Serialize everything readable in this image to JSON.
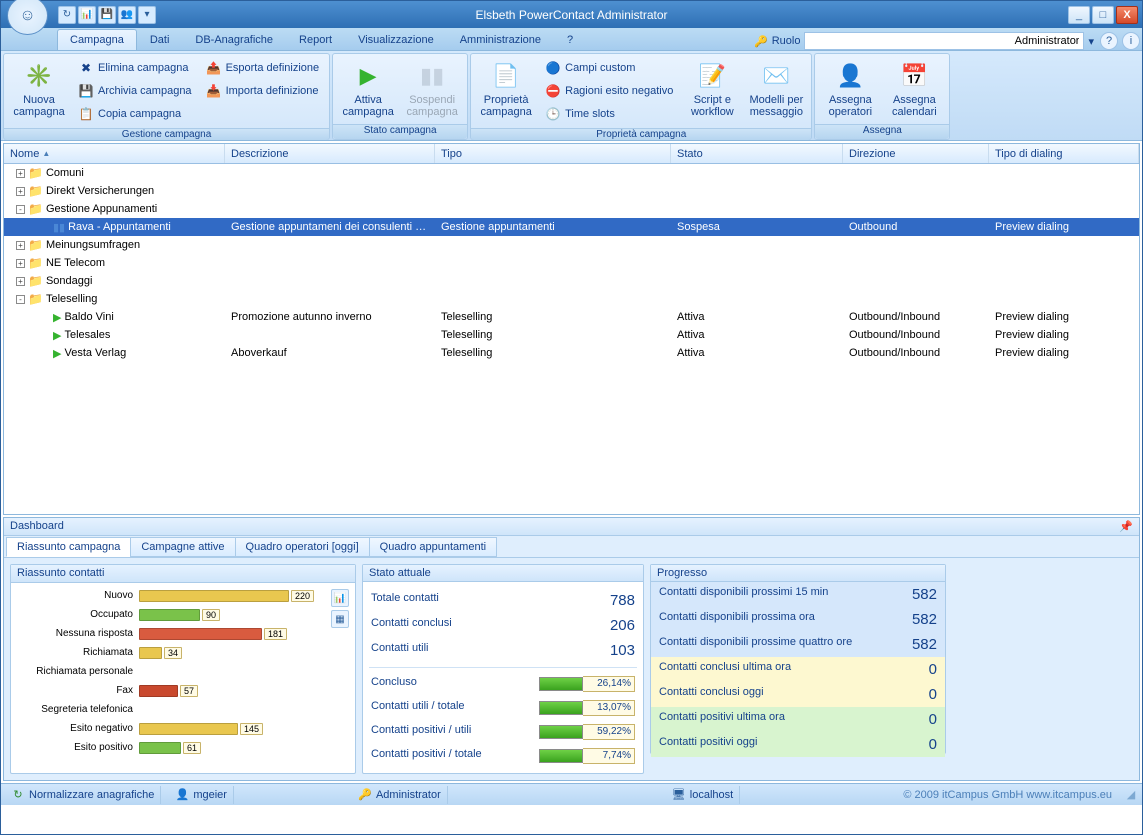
{
  "app_title": "Elsbeth PowerContact Administrator",
  "qat": [
    "↻",
    "📊",
    "💾",
    "👥",
    "▾"
  ],
  "window_buttons": {
    "min": "_",
    "max": "□",
    "close": "X"
  },
  "menu_tabs": [
    "Campagna",
    "Dati",
    "DB-Anagrafiche",
    "Report",
    "Visualizzazione",
    "Amministrazione",
    "?"
  ],
  "ruolo_label": "Ruolo",
  "ruolo_value": "Administrator",
  "ribbon_groups": {
    "gestione": {
      "label": "Gestione campagna",
      "big": {
        "label": "Nuova campagna"
      },
      "col1": [
        "Elimina campagna",
        "Archivia campagna",
        "Copia campagna"
      ],
      "col2": [
        "Esporta definizione",
        "Importa definizione"
      ]
    },
    "stato": {
      "label": "Stato campagna",
      "attiva": "Attiva campagna",
      "sospendi": "Sospendi campagna"
    },
    "proprieta": {
      "label": "Proprietà campagna",
      "big": "Proprietà campagna",
      "col": [
        "Campi custom",
        "Ragioni esito negativo",
        "Time slots"
      ],
      "script": "Script e workflow",
      "modelli": "Modelli per messaggio"
    },
    "assegna": {
      "label": "Assegna",
      "op": "Assegna operatori",
      "cal": "Assegna calendari"
    }
  },
  "grid_cols": [
    "Nome",
    "Descrizione",
    "Tipo",
    "Stato",
    "Direzione",
    "Tipo di dialing"
  ],
  "tree": [
    {
      "t": "folder",
      "exp": "+",
      "depth": 0,
      "name": "Comuni"
    },
    {
      "t": "folder",
      "exp": "+",
      "depth": 0,
      "name": "Direkt Versicherungen"
    },
    {
      "t": "folder",
      "exp": "-",
      "depth": 0,
      "name": "Gestione Appunamenti"
    },
    {
      "t": "camp",
      "icon": "pause",
      "depth": 1,
      "sel": true,
      "name": "Rava - Appuntamenti",
      "desc": "Gestione appuntameni dei consulenti di ...",
      "tipo": "Gestione appuntamenti",
      "stato": "Sospesa",
      "dir": "Outbound",
      "dial": "Preview dialing"
    },
    {
      "t": "folder",
      "exp": "+",
      "depth": 0,
      "name": "Meinungsumfragen"
    },
    {
      "t": "folder",
      "exp": "+",
      "depth": 0,
      "name": "NE Telecom"
    },
    {
      "t": "folder",
      "exp": "+",
      "depth": 0,
      "name": "Sondaggi"
    },
    {
      "t": "folder",
      "exp": "-",
      "depth": 0,
      "name": "Teleselling"
    },
    {
      "t": "camp",
      "icon": "play",
      "depth": 1,
      "name": "Baldo Vini",
      "desc": "Promozione autunno inverno",
      "tipo": "Teleselling",
      "stato": "Attiva",
      "dir": "Outbound/Inbound",
      "dial": "Preview dialing"
    },
    {
      "t": "camp",
      "icon": "play",
      "depth": 1,
      "name": "Telesales",
      "desc": "",
      "tipo": "Teleselling",
      "stato": "Attiva",
      "dir": "Outbound/Inbound",
      "dial": "Preview dialing"
    },
    {
      "t": "camp",
      "icon": "play",
      "depth": 1,
      "name": "Vesta Verlag",
      "desc": "Aboverkauf",
      "tipo": "Teleselling",
      "stato": "Attiva",
      "dir": "Outbound/Inbound",
      "dial": "Preview dialing"
    }
  ],
  "dashboard_title": "Dashboard",
  "dash_tabs": [
    "Riassunto campagna",
    "Campagne attive",
    "Quadro operatori [oggi]",
    "Quadro appuntamenti"
  ],
  "panel_titles": {
    "chart": "Riassunto contatti",
    "stato": "Stato attuale",
    "prog": "Progresso"
  },
  "chart_data": {
    "type": "bar",
    "orientation": "horizontal",
    "categories": [
      "Nuovo",
      "Occupato",
      "Nessuna risposta",
      "Richiamata",
      "Richiamata personale",
      "Fax",
      "Segreteria telefonica",
      "Esito negativo",
      "Esito positivo"
    ],
    "values": [
      220,
      90,
      181,
      34,
      0,
      57,
      0,
      145,
      61
    ],
    "max": 220,
    "colors": [
      "#e9c74f",
      "#7ac24a",
      "#d95b3f",
      "#e9c74f",
      "#bdbdbd",
      "#c9492e",
      "#bdbdbd",
      "#e9c74f",
      "#7ac24a"
    ],
    "title": "Riassunto contatti",
    "xlabel": "",
    "ylabel": ""
  },
  "stato_rows": [
    {
      "l": "Totale contatti",
      "v": "788"
    },
    {
      "l": "Contatti conclusi",
      "v": "206"
    },
    {
      "l": "Contatti utili",
      "v": "103"
    }
  ],
  "stato_pct": [
    {
      "l": "Concluso",
      "v": "26,14%"
    },
    {
      "l": "Contatti utili / totale",
      "v": "13,07%"
    },
    {
      "l": "Contatti positivi / utili",
      "v": "59,22%"
    },
    {
      "l": "Contatti positivi / totale",
      "v": "7,74%"
    }
  ],
  "prog_rows": [
    {
      "cls": "blue",
      "l": "Contatti disponibili prossimi 15 min",
      "v": "582"
    },
    {
      "cls": "blue",
      "l": "Contatti disponibili prossima ora",
      "v": "582"
    },
    {
      "cls": "blue",
      "l": "Contatti disponibili prossime quattro ore",
      "v": "582"
    },
    {
      "cls": "yellow",
      "l": "Contatti conclusi ultima ora",
      "v": "0"
    },
    {
      "cls": "yellow",
      "l": "Contatti conclusi oggi",
      "v": "0"
    },
    {
      "cls": "green",
      "l": "Contatti positivi ultima ora",
      "v": "0"
    },
    {
      "cls": "green",
      "l": "Contatti positivi oggi",
      "v": "0"
    }
  ],
  "status_segments": {
    "normalize": "Normalizzare anagrafiche",
    "user": "mgeier",
    "role": "Administrator",
    "host": "localhost",
    "copyright": "© 2009 itCampus GmbH www.itcampus.eu"
  }
}
